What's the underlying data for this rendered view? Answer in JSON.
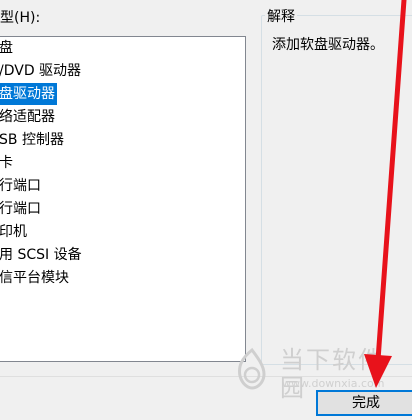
{
  "device_type_label": "型(H):",
  "device_list": [
    "盘",
    "/DVD 驱动器",
    "盘驱动器",
    "络适配器",
    "SB 控制器",
    "卡",
    "行端口",
    "行端口",
    "印机",
    "用 SCSI 设备",
    "信平台模块"
  ],
  "selected_index": 2,
  "description_group_label": "解释",
  "description_text": "添加软盘驱动器。",
  "finish_button_label": "完成",
  "watermark_title": "当下软件园",
  "watermark_url": "www.downxia.com",
  "colors": {
    "selection": "#0078d7",
    "arrow": "#e8121b"
  }
}
